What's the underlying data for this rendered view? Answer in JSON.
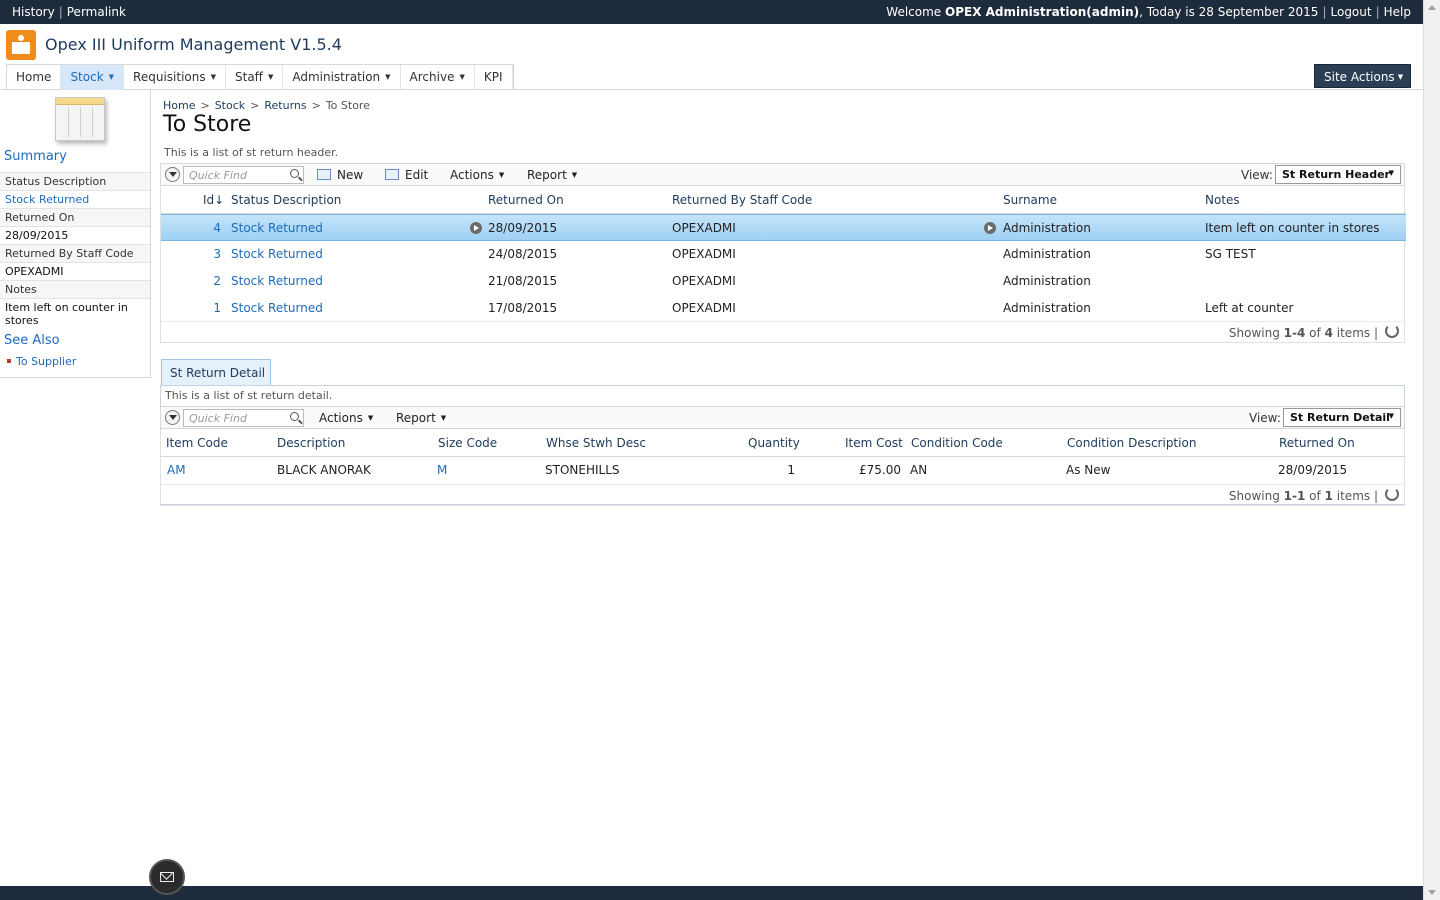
{
  "topbar": {
    "history": "History",
    "permalink": "Permalink",
    "welcome_prefix": "Welcome",
    "user": "OPEX Administration(admin)",
    "today": ", Today is 28 September 2015",
    "logout": "Logout",
    "help": "Help"
  },
  "header": {
    "app_title": "Opex III Uniform Management V1.5.4",
    "site_actions": "Site Actions",
    "nav": [
      {
        "label": "Home",
        "has_menu": false,
        "active": false
      },
      {
        "label": "Stock",
        "has_menu": true,
        "active": true
      },
      {
        "label": "Requisitions",
        "has_menu": true,
        "active": false
      },
      {
        "label": "Staff",
        "has_menu": true,
        "active": false
      },
      {
        "label": "Administration",
        "has_menu": true,
        "active": false
      },
      {
        "label": "Archive",
        "has_menu": true,
        "active": false
      },
      {
        "label": "KPI",
        "has_menu": false,
        "active": false
      }
    ]
  },
  "sidebar": {
    "summary_heading": "Summary",
    "fields": [
      {
        "label": "Status Description",
        "value": "Stock Returned",
        "value_is_link": true
      },
      {
        "label": "Returned On",
        "value": "28/09/2015",
        "value_is_link": false
      },
      {
        "label": "Returned By Staff Code",
        "value": "OPEXADMI",
        "value_is_link": false
      },
      {
        "label": "Notes",
        "value": "Item left on counter in stores",
        "value_is_link": false
      }
    ],
    "see_also_heading": "See Also",
    "see_also_links": [
      "To Supplier"
    ]
  },
  "breadcrumb": [
    "Home",
    "Stock",
    "Returns",
    "To Store"
  ],
  "page_title": "To Store",
  "header_list": {
    "description": "This is a list of st return header.",
    "quick_find_placeholder": "Quick Find",
    "toolbar": {
      "new": "New",
      "edit": "Edit",
      "actions": "Actions",
      "report": "Report"
    },
    "view_label": "View:",
    "view_value": "St Return Header",
    "columns": [
      "Id",
      "Status Description",
      "Returned On",
      "Returned By Staff Code",
      "Surname",
      "Notes"
    ],
    "sort_indicator": "↓",
    "rows": [
      {
        "id": "4",
        "status": "Stock Returned",
        "returned_on": "28/09/2015",
        "staff_code": "OPEXADMI",
        "surname": "Administration",
        "notes": "Item left on counter in stores",
        "selected": true
      },
      {
        "id": "3",
        "status": "Stock Returned",
        "returned_on": "24/08/2015",
        "staff_code": "OPEXADMI",
        "surname": "Administration",
        "notes": "SG TEST",
        "selected": false
      },
      {
        "id": "2",
        "status": "Stock Returned",
        "returned_on": "21/08/2015",
        "staff_code": "OPEXADMI",
        "surname": "Administration",
        "notes": "",
        "selected": false
      },
      {
        "id": "1",
        "status": "Stock Returned",
        "returned_on": "17/08/2015",
        "staff_code": "OPEXADMI",
        "surname": "Administration",
        "notes": "Left at counter",
        "selected": false
      }
    ],
    "showing": {
      "prefix": "Showing",
      "range": "1-4",
      "of": "of",
      "total": "4",
      "suffix": "items"
    }
  },
  "detail_list": {
    "tab_label": "St Return Detail",
    "description": "This is a list of st return detail.",
    "quick_find_placeholder": "Quick Find",
    "toolbar": {
      "actions": "Actions",
      "report": "Report"
    },
    "view_label": "View:",
    "view_value": "St Return Detail",
    "columns": [
      "Item Code",
      "Description",
      "Size Code",
      "Whse Stwh Desc",
      "Quantity",
      "Item Cost",
      "Condition Code",
      "Condition Description",
      "Returned On"
    ],
    "rows": [
      {
        "item_code": "AM",
        "description": "BLACK ANORAK",
        "size_code": "M",
        "whse": "STONEHILLS",
        "quantity": "1",
        "item_cost": "£75.00",
        "condition_code": "AN",
        "condition_description": "As New",
        "returned_on": "28/09/2015"
      }
    ],
    "showing": {
      "prefix": "Showing",
      "range": "1-1",
      "of": "of",
      "total": "1",
      "suffix": "items"
    }
  },
  "colors": {
    "topbar_bg": "#1d2b3c",
    "link": "#1e6bb8",
    "selected_row": "#a7d5f5",
    "logo": "#f08c1a"
  }
}
